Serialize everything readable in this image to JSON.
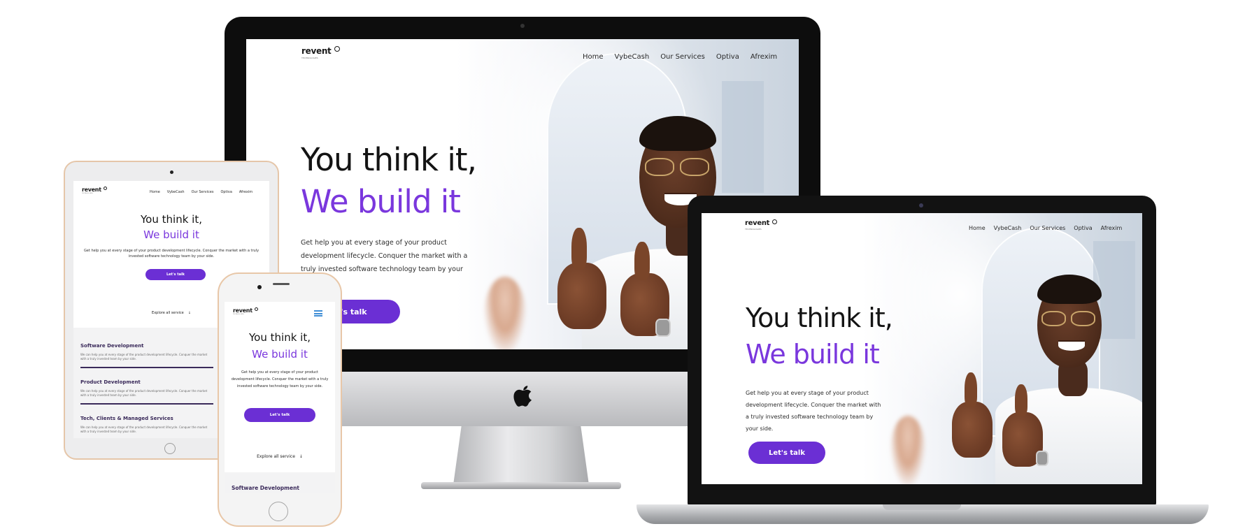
{
  "site": {
    "logo_text": "revent",
    "logo_tagline": "TECHNOLOGIES",
    "nav": [
      "Home",
      "VybeCash",
      "Our Services",
      "Optiva",
      "Afrexim"
    ],
    "headline_1": "You think it,",
    "headline_2": "We build it",
    "subtitle": "Get help you at every stage of your product development lifecycle. Conquer the market with a truly invested software technology team by your side.",
    "cta_label": "Let's talk",
    "cta_label_cropped": "Let's talk",
    "explore_label": "Explore all service",
    "services": [
      {
        "title": "Software Development",
        "desc": "We can help you at every stage of the product development lifecycle. Conquer the market with a truly invested team by your side."
      },
      {
        "title": "Product Development",
        "desc": "We can help you at every stage of the product development lifecycle. Conquer the market with a truly invested team by your side."
      },
      {
        "title": "Tech, Clients & Managed Services",
        "desc": "We can help you at every stage of the product development lifecycle. Conquer the market with a truly invested team by your side."
      }
    ]
  },
  "colors": {
    "accent_purple": "#7a37dd",
    "button_purple": "#6b2fd4",
    "heading_dark": "#141414"
  },
  "icons": {
    "imac_logo": "apple-icon",
    "mobile_menu": "hamburger-icon",
    "explore_arrow": "arrow-down-icon"
  }
}
